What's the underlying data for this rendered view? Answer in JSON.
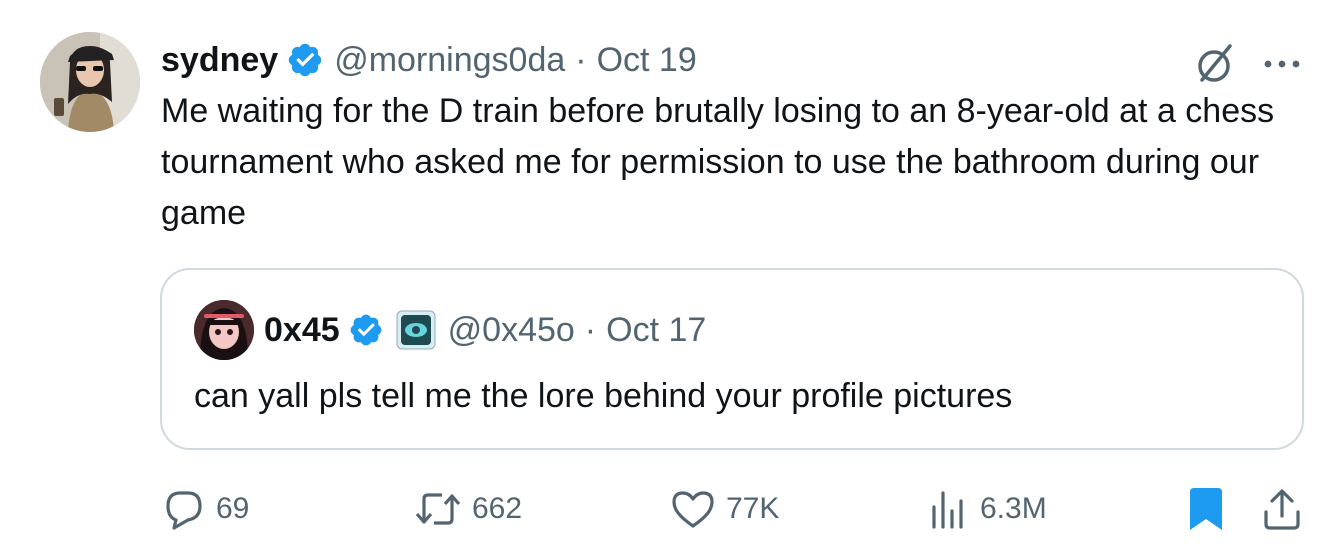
{
  "author": {
    "display_name": "sydney",
    "handle": "@mornings0da",
    "separator": "·",
    "date": "Oct 19",
    "verified_color": "#1d9bf0"
  },
  "tweet": {
    "text": "Me waiting for the D train before brutally losing to an 8-year-old at a chess tournament who asked me for permission to use the bathroom during our game"
  },
  "quoted": {
    "display_name": "0x45",
    "handle": "@0x45o",
    "separator": "·",
    "date": "Oct 17",
    "text": "can yall pls tell me the lore behind your profile pictures"
  },
  "actions": {
    "replies": "69",
    "reposts": "662",
    "likes": "77K",
    "views": "6.3M"
  },
  "icons": {
    "grok": "grok-slash-icon",
    "more": "more-dots-icon",
    "reply": "reply-icon",
    "repost": "repost-icon",
    "like": "heart-icon",
    "views": "views-bar-icon",
    "bookmark": "bookmark-icon",
    "share": "share-icon"
  },
  "colors": {
    "text": "#0f1419",
    "muted": "#536471",
    "accent": "#1d9bf0",
    "border": "#cfd9de"
  }
}
